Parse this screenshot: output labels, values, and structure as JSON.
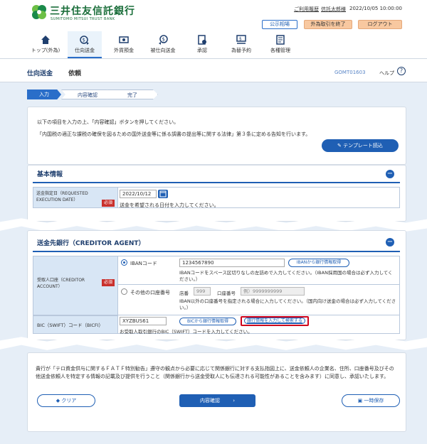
{
  "header": {
    "logo_jp": "三井住友信託銀行",
    "logo_en": "SUMITOMO MITSUI TRUST BANK",
    "link_history": "ご利用履歴",
    "user_name": "信託太郎様",
    "datetime": "2022/10/05 10:00:00",
    "btn_notice": "公示相場",
    "btn_fx_end": "外為取引を終了",
    "btn_logout": "ログアウト"
  },
  "nav": {
    "items": [
      {
        "label": "トップ(外為)",
        "icon": "home-icon"
      },
      {
        "label": "仕向送金",
        "icon": "remit-icon"
      },
      {
        "label": "外貨預金",
        "icon": "deposit-icon"
      },
      {
        "label": "被仕向送金",
        "icon": "incoming-icon"
      },
      {
        "label": "承認",
        "icon": "approve-icon"
      },
      {
        "label": "為替予約",
        "icon": "fx-icon"
      },
      {
        "label": "各種管理",
        "icon": "manage-icon"
      }
    ]
  },
  "titlebar": {
    "title": "仕向送金",
    "subtitle": "依頼",
    "code": "GOMT01603",
    "help": "ヘルプ"
  },
  "steps": [
    "入力",
    "内容確認",
    "完了"
  ],
  "intro": {
    "line1": "以下の項目を入力の上、「内容確認」ボタンを押してください。",
    "line2": "「内国税の適正な課税の確保を図るための国外送金等に係る調書の提出等に関する法律」第３条に定める告知を行います。",
    "btn_template": "テンプレート読込"
  },
  "basic": {
    "heading": "基本情報",
    "exec_date_label": "送金指定日（REQUESTED EXECUTION DATE）",
    "required": "必須",
    "exec_date_value": "2022/10/12",
    "exec_date_help": "送金を希望される日付を入力してください。"
  },
  "agent": {
    "heading": "送金先銀行（CREDITOR AGENT）",
    "account_label": "受取人口座（CREDITOR ACCOUNT）",
    "required": "必須",
    "iban_label": "IBANコード",
    "iban_value": "1234567890",
    "btn_iban": "IBANから銀行情報取得",
    "iban_help": "IBANコードをスペース区切りなしの左詰めで入力してください。（IBAN採用国の場合は必ず入力してください。）",
    "other_label": "その他の口座番号",
    "branch_label": "店番",
    "branch_placeholder": "999",
    "account_no_label": "口座番号",
    "account_no_placeholder": "例）9999999999",
    "other_help": "IBAN以外の口座番号を指定される場合に入力してください。（国内向け送金の場合は必ず入力してください。）",
    "bic_label": "BIC（SWIFT）コード（BICFI）",
    "bic_value": "XYZBUS61",
    "btn_bic": "BICから銀行情報取得",
    "btn_branch": "銀行情報を入力して検索する",
    "bic_help": "お受取人取引銀行のBIC（SWIFT）コードを入力してください。"
  },
  "footer": {
    "notice": "貴行が「テロ資金供与に関するＦＡＴＦ特別勧告」遵守の観点から必要に応じて関係銀行に対する支払指図上に、送金依頼人の企業名、住所、口座番号及びその他送金依頼人を特定する情報の記載及び提供を行うこと（関係銀行から送金受取人にも伝達される可能性があることを含みます）に同意し、承認いたします。",
    "btn_clear": "クリア",
    "btn_confirm": "内容確認",
    "btn_save": "一時保存"
  }
}
